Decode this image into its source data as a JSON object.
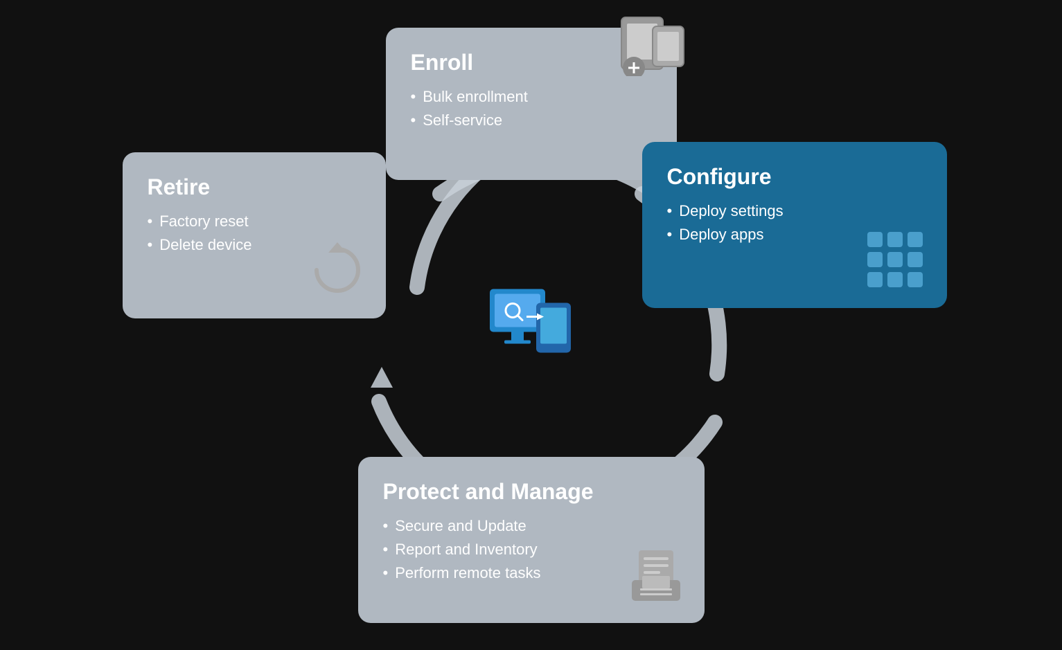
{
  "cards": {
    "enroll": {
      "title": "Enroll",
      "items": [
        "Bulk enrollment",
        "Self-service"
      ],
      "style": "gray"
    },
    "configure": {
      "title": "Configure",
      "items": [
        "Deploy settings",
        "Deploy apps"
      ],
      "style": "blue"
    },
    "retire": {
      "title": "Retire",
      "items": [
        "Factory reset",
        "Delete device"
      ],
      "style": "gray"
    },
    "protect": {
      "title": "Protect and Manage",
      "items": [
        "Secure and Update",
        "Report and Inventory",
        "Perform remote tasks"
      ],
      "style": "gray"
    }
  },
  "colors": {
    "gray_card": "#b0b8c1",
    "blue_card": "#1a6b96",
    "ring": "#c8d0d8",
    "arrow": "#b0bcc8"
  }
}
